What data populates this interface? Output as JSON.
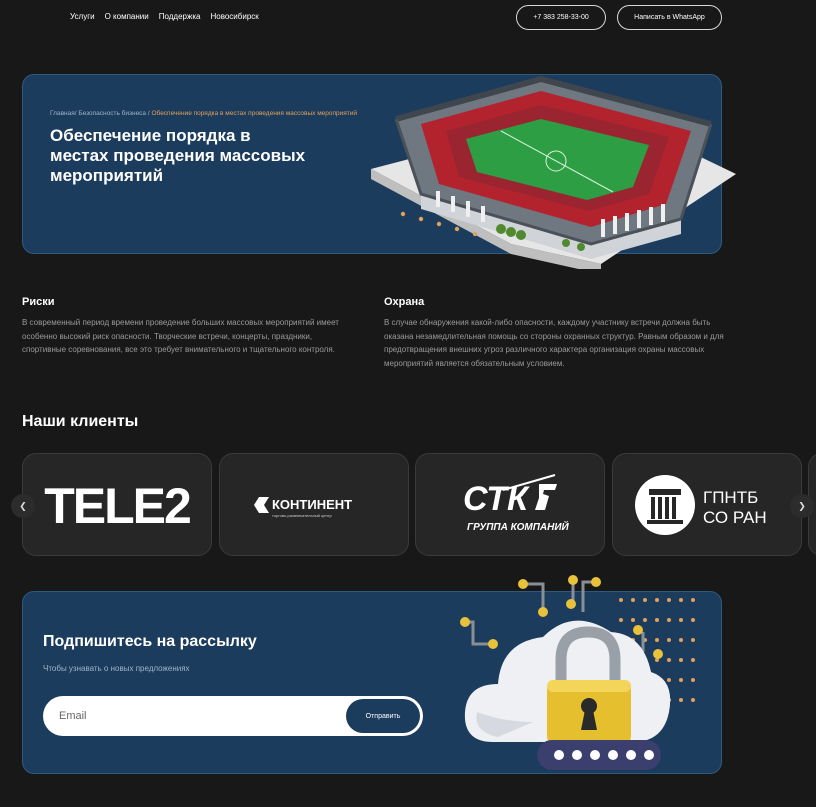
{
  "header": {
    "nav": [
      "Услуги",
      "О компании",
      "Поддержка",
      "Новосибирск"
    ],
    "phone": "+7 383 258-33-00",
    "whatsapp": "Написать в WhatsApp"
  },
  "hero": {
    "breadcrumbs": [
      "Главная",
      "Безопасность бизнеса",
      "Обеспечение порядка в местах проведения массовых мероприятий"
    ],
    "title": "Обеспечение порядка в местах проведения массовых мероприятий"
  },
  "info": {
    "risks": {
      "title": "Риски",
      "text": "В современный период времени проведение больших массовых мероприятий имеет особенно высокий риск опасности. Творческие встречи, концерты, праздники, спортивные соревнования, все это требует внимательного и тщательного контроля."
    },
    "guard": {
      "title": "Охрана",
      "text": "В случае обнаружения какой-либо опасности, каждому участнику встречи должна быть оказана незамедлительная помощь со стороны охранных структур. Равным образом и для предотвращения внешних угроз различного характера организация охраны массовых мероприятий является обязательным условием."
    }
  },
  "clients": {
    "title": "Наши клиенты",
    "logos": {
      "tele2": "TELE2",
      "kontinent": "КОНТИНЕНТ",
      "kontinent_sub": "торгово-развлекательный центр",
      "stk": "СТК",
      "stk_sub": "ГРУППА КОМПАНИЙ",
      "gpntb1": "ГПНТБ",
      "gpntb2": "СО РАН"
    },
    "prev_icon": "chevron-left-icon",
    "next_icon": "chevron-right-icon"
  },
  "subscribe": {
    "title": "Подпишитесь на рассылку",
    "lead": "Чтобы узнавать о новых предложениях",
    "email_placeholder": "Email",
    "button": "Отправить"
  },
  "colors": {
    "bg": "#181818",
    "panel": "#1b3c5c",
    "accent": "#e0a15c",
    "card": "#262626"
  }
}
